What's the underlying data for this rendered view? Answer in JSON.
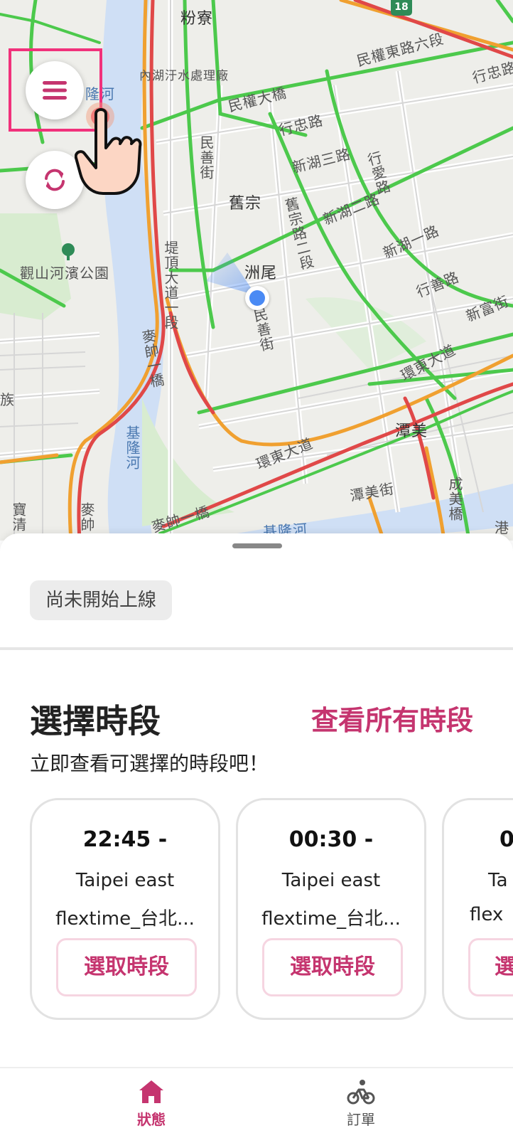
{
  "map": {
    "labels": {
      "fenliao": "粉寮",
      "neihu_water": "內湖汙水處理廠",
      "longhe_top": "隆河",
      "minquan_bridge": "民權大橋",
      "minquan_e6": "民權東路六段",
      "xingzhong_right": "行忠路",
      "xingzhong": "行忠路",
      "xinhu3": "新湖三路",
      "xingai": "行愛路",
      "minshan1": "民善街",
      "jiuzong": "舊宗",
      "jiuzong_rd1": "舊宗路二段",
      "xinhu2": "新湖二路",
      "xinhu1": "新湖一路",
      "zhouwei": "洲尾",
      "xingshan": "行善路",
      "xinfu": "新富街",
      "guanshan_park": "觀山河濱公園",
      "diding": "堤頂大道一段",
      "maishi": "麥帥一橋",
      "minshan2": "民善街",
      "huandong": "環東大道",
      "huandong2": "環東大道",
      "tanmei": "潭美",
      "tanmei_st": "潭美街",
      "chengmei": "成美橋",
      "keelung_river": "基隆河",
      "maishi2": "麥帥一橋",
      "zu": "族",
      "baoqing": "寶清",
      "maishi_v": "麥帥",
      "gang": "港",
      "route_shield": "18",
      "longhe_bottom": "基隆河"
    }
  },
  "controls": {
    "menu_icon": "hamburger-menu-icon",
    "refresh_icon": "refresh-icon",
    "pointer_icon": "tap-hand-icon"
  },
  "sheet": {
    "status_chip": "尚未開始上線",
    "section_title": "選擇時段",
    "see_all": "查看所有時段",
    "subtitle": "立即查看可選擇的時段吧！",
    "cards": [
      {
        "time": "22:45 -",
        "area": "Taipei east",
        "zone": "flextime_台北...",
        "button": "選取時段"
      },
      {
        "time": "00:30 -",
        "area": "Taipei east",
        "zone": "flextime_台北...",
        "button": "選取時段"
      },
      {
        "time": "0",
        "area": "Ta",
        "zone": "flex",
        "button": "選"
      }
    ]
  },
  "nav": {
    "status_label": "狀態",
    "orders_label": "訂單",
    "status_icon": "home-icon",
    "orders_icon": "bicycle-courier-icon"
  },
  "colors": {
    "accent": "#c5356f",
    "highlight": "#f1317b",
    "traffic_green": "#4cc94c",
    "traffic_orange": "#f0a030",
    "traffic_red": "#e04848",
    "location_blue": "#4a8af4"
  }
}
